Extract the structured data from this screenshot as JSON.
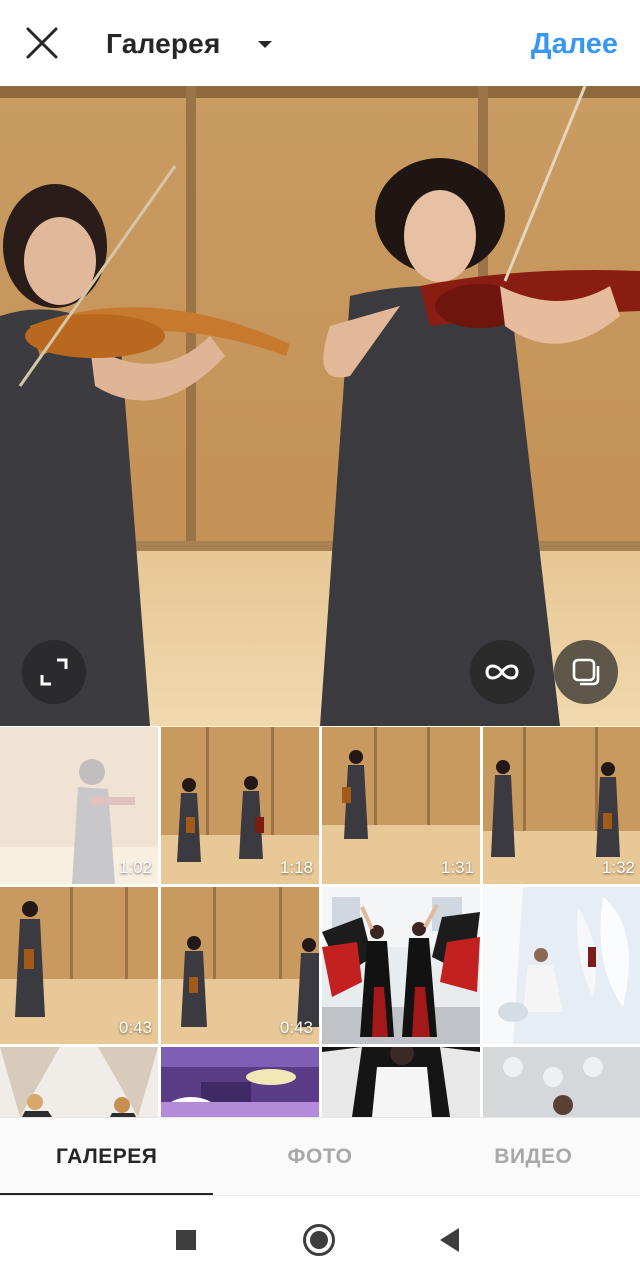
{
  "header": {
    "title": "Галерея",
    "next_label": "Далее"
  },
  "icons": {
    "close": "close-icon",
    "dropdown": "chevron-down-icon",
    "expand": "expand-icon",
    "boomerang": "infinity-icon",
    "multi_select": "multi-select-icon"
  },
  "grid": {
    "items": [
      {
        "duration": "1:02",
        "selected": true
      },
      {
        "duration": "1:18"
      },
      {
        "duration": "1:31"
      },
      {
        "duration": "1:32"
      },
      {
        "duration": "0:43"
      },
      {
        "duration": "0:43"
      },
      {
        "duration": ""
      },
      {
        "duration": ""
      },
      {
        "duration": ""
      },
      {
        "duration": ""
      },
      {
        "duration": ""
      },
      {
        "duration": ""
      }
    ]
  },
  "tabs": [
    {
      "label": "ГАЛЕРЕЯ",
      "active": true
    },
    {
      "label": "ФОТО",
      "active": false
    },
    {
      "label": "ВИДЕО",
      "active": false
    }
  ],
  "colors": {
    "accent": "#3897f0",
    "text": "#262626",
    "inactive": "#a8a8a8"
  }
}
